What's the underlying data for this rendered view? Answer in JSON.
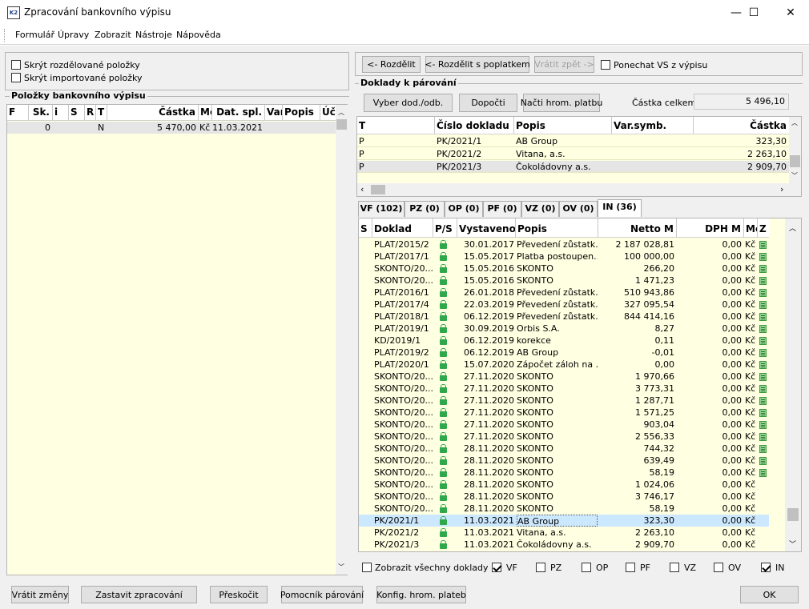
{
  "window": {
    "title": "Zpracování bankovního výpisu",
    "minimize": "—",
    "maximize": "☐",
    "close": "✕"
  },
  "menu": [
    "Formulář",
    "Úpravy",
    "Zobrazit",
    "Nástroje",
    "Nápověda"
  ],
  "left": {
    "cb_hide_split": "Skrýt rozdělované položky",
    "cb_hide_imported": "Skrýt importované položky",
    "group_title": "Položky bankovního výpisu",
    "columns": [
      "F",
      "Sk.",
      "i",
      "S",
      "R",
      "T",
      "Částka",
      "Mě",
      "Dat. spl.",
      "Var",
      "Popis",
      "Úč"
    ],
    "rows": [
      {
        "sk": "0",
        "i": "",
        "s": "",
        "r": "",
        "t": "N",
        "castka": "5 470,00",
        "mena": "Kč",
        "dat": "11.03.2021",
        "var": "",
        "popis": ""
      }
    ]
  },
  "right_top": {
    "btn_split": "<- Rozdělit",
    "btn_split_fee": "<- Rozdělit s poplatkem",
    "btn_undo": "Vrátit zpět ->",
    "cb_keep_vs": "Ponechat VS z výpisu",
    "group_title": "Doklady k párování",
    "btn_select": "Vyber dod./odb.",
    "btn_recalc": "Dopočti",
    "btn_load_bulk": "Načti hrom. platbu",
    "total_label": "Částka celkem:",
    "total_value": "5 496,10",
    "columns": [
      "T",
      "Číslo dokladu",
      "Popis",
      "Var.symb.",
      "Částka"
    ],
    "rows": [
      {
        "t": "P",
        "cislo": "PK/2021/1",
        "popis": "AB Group",
        "var": "",
        "castka": "323,30"
      },
      {
        "t": "P",
        "cislo": "PK/2021/2",
        "popis": "Vitana, a.s.",
        "var": "",
        "castka": "2 263,10"
      },
      {
        "t": "P",
        "cislo": "PK/2021/3",
        "popis": "Čokoládovny a.s.",
        "var": "",
        "castka": "2 909,70"
      }
    ]
  },
  "tabs": [
    "VF (102)",
    "PZ (0)",
    "OP (0)",
    "PF (0)",
    "VZ (0)",
    "OV (0)",
    "IN (36)"
  ],
  "doc_grid": {
    "columns": [
      "S",
      "Doklad",
      "P/S",
      "Vystaveno",
      "Popis",
      "Netto M",
      "DPH M",
      "Mě",
      "Z"
    ],
    "rows": [
      {
        "doklad": "PLAT/2015/2",
        "vyst": "30.01.2017",
        "popis": "Převedení zůstatk...",
        "netto": "2 187 028,81",
        "dph": "0,00",
        "mena": "Kč",
        "z": true
      },
      {
        "doklad": "PLAT/2017/1",
        "vyst": "15.05.2017",
        "popis": "Platba postoupen...",
        "netto": "100 000,00",
        "dph": "0,00",
        "mena": "Kč",
        "z": true
      },
      {
        "doklad": "SKONTO/20...",
        "vyst": "15.05.2016",
        "popis": "SKONTO",
        "netto": "266,20",
        "dph": "0,00",
        "mena": "Kč",
        "z": true
      },
      {
        "doklad": "SKONTO/20...",
        "vyst": "15.05.2016",
        "popis": "SKONTO",
        "netto": "1 471,23",
        "dph": "0,00",
        "mena": "Kč",
        "z": true
      },
      {
        "doklad": "PLAT/2016/1",
        "vyst": "26.01.2018",
        "popis": "Převedení zůstatk...",
        "netto": "510 943,86",
        "dph": "0,00",
        "mena": "Kč",
        "z": true
      },
      {
        "doklad": "PLAT/2017/4",
        "vyst": "22.03.2019",
        "popis": "Převedení zůstatk...",
        "netto": "327 095,54",
        "dph": "0,00",
        "mena": "Kč",
        "z": true
      },
      {
        "doklad": "PLAT/2018/1",
        "vyst": "06.12.2019",
        "popis": "Převedení zůstatk...",
        "netto": "844 414,16",
        "dph": "0,00",
        "mena": "Kč",
        "z": true
      },
      {
        "doklad": "PLAT/2019/1",
        "vyst": "30.09.2019",
        "popis": "Orbis S.A.",
        "netto": "8,27",
        "dph": "0,00",
        "mena": "Kč",
        "z": true
      },
      {
        "doklad": "KD/2019/1",
        "vyst": "06.12.2019",
        "popis": "korekce",
        "netto": "0,11",
        "dph": "0,00",
        "mena": "Kč",
        "z": true
      },
      {
        "doklad": "PLAT/2019/2",
        "vyst": "06.12.2019",
        "popis": "AB Group",
        "netto": "-0,01",
        "dph": "0,00",
        "mena": "Kč",
        "z": true
      },
      {
        "doklad": "PLAT/2020/1",
        "vyst": "15.07.2020",
        "popis": "Zápočet záloh na ...",
        "netto": "0,00",
        "dph": "0,00",
        "mena": "Kč",
        "z": true
      },
      {
        "doklad": "SKONTO/20...",
        "vyst": "27.11.2020",
        "popis": "SKONTO",
        "netto": "1 970,66",
        "dph": "0,00",
        "mena": "Kč",
        "z": true
      },
      {
        "doklad": "SKONTO/20...",
        "vyst": "27.11.2020",
        "popis": "SKONTO",
        "netto": "3 773,31",
        "dph": "0,00",
        "mena": "Kč",
        "z": true
      },
      {
        "doklad": "SKONTO/20...",
        "vyst": "27.11.2020",
        "popis": "SKONTO",
        "netto": "1 287,71",
        "dph": "0,00",
        "mena": "Kč",
        "z": true
      },
      {
        "doklad": "SKONTO/20...",
        "vyst": "27.11.2020",
        "popis": "SKONTO",
        "netto": "1 571,25",
        "dph": "0,00",
        "mena": "Kč",
        "z": true
      },
      {
        "doklad": "SKONTO/20...",
        "vyst": "27.11.2020",
        "popis": "SKONTO",
        "netto": "903,04",
        "dph": "0,00",
        "mena": "Kč",
        "z": true
      },
      {
        "doklad": "SKONTO/20...",
        "vyst": "27.11.2020",
        "popis": "SKONTO",
        "netto": "2 556,33",
        "dph": "0,00",
        "mena": "Kč",
        "z": true
      },
      {
        "doklad": "SKONTO/20...",
        "vyst": "28.11.2020",
        "popis": "SKONTO",
        "netto": "744,32",
        "dph": "0,00",
        "mena": "Kč",
        "z": true
      },
      {
        "doklad": "SKONTO/20...",
        "vyst": "28.11.2020",
        "popis": "SKONTO",
        "netto": "639,49",
        "dph": "0,00",
        "mena": "Kč",
        "z": true
      },
      {
        "doklad": "SKONTO/20...",
        "vyst": "28.11.2020",
        "popis": "SKONTO",
        "netto": "58,19",
        "dph": "0,00",
        "mena": "Kč",
        "z": true
      },
      {
        "doklad": "SKONTO/20...",
        "vyst": "28.11.2020",
        "popis": "SKONTO",
        "netto": "1 024,06",
        "dph": "0,00",
        "mena": "Kč",
        "z": false
      },
      {
        "doklad": "SKONTO/20...",
        "vyst": "28.11.2020",
        "popis": "SKONTO",
        "netto": "3 746,17",
        "dph": "0,00",
        "mena": "Kč",
        "z": false
      },
      {
        "doklad": "SKONTO/20...",
        "vyst": "28.11.2020",
        "popis": "SKONTO",
        "netto": "58,19",
        "dph": "0,00",
        "mena": "Kč",
        "z": false
      },
      {
        "doklad": "PK/2021/1",
        "vyst": "11.03.2021",
        "popis": "AB Group",
        "netto": "323,30",
        "dph": "0,00",
        "mena": "Kč",
        "z": false
      },
      {
        "doklad": "PK/2021/2",
        "vyst": "11.03.2021",
        "popis": "Vitana, a.s.",
        "netto": "2 263,10",
        "dph": "0,00",
        "mena": "Kč",
        "z": false
      },
      {
        "doklad": "PK/2021/3",
        "vyst": "11.03.2021",
        "popis": "Čokoládovny a.s.",
        "netto": "2 909,70",
        "dph": "0,00",
        "mena": "Kč",
        "z": false
      }
    ]
  },
  "filters": {
    "show_all": "Zobrazit všechny doklady",
    "items": [
      {
        "label": "VF",
        "checked": true
      },
      {
        "label": "PZ",
        "checked": false
      },
      {
        "label": "OP",
        "checked": false
      },
      {
        "label": "PF",
        "checked": false
      },
      {
        "label": "VZ",
        "checked": false
      },
      {
        "label": "OV",
        "checked": false
      },
      {
        "label": "IN",
        "checked": true
      }
    ]
  },
  "bottom": {
    "revert": "Vrátit změny",
    "stop": "Zastavit zpracování",
    "skip": "Přeskočit",
    "assistant": "Pomocník párování",
    "config": "Konfig. hrom. plateb",
    "ok": "OK"
  },
  "colors": {
    "grid_bg": "#ffffe1",
    "selected_row": "#cce8ff",
    "grey_row": "#e5e5e5",
    "lock_green": "#2ea84a"
  }
}
